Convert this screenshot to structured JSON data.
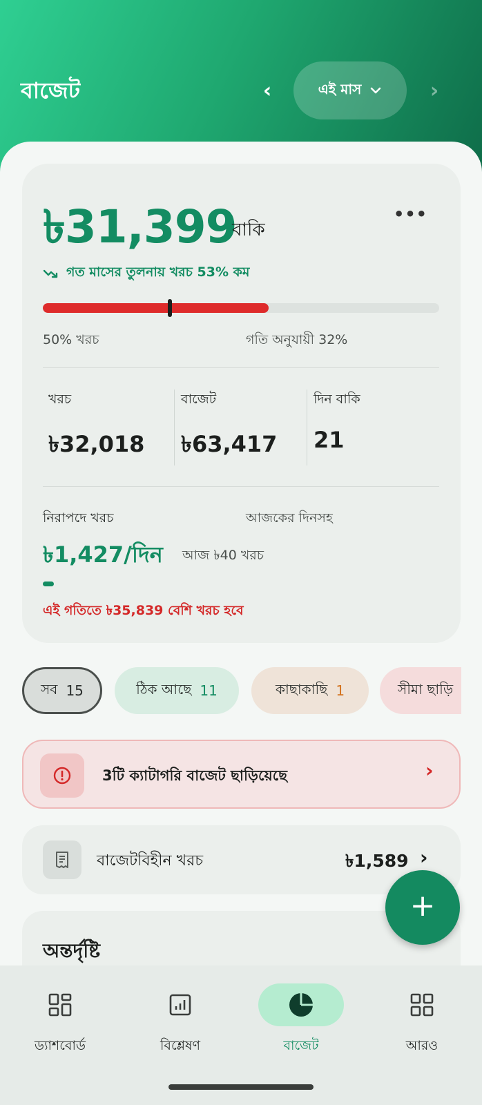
{
  "header": {
    "title": "বাজেট",
    "period_label": "এই মাস",
    "prev_icon": "chevron-left-icon",
    "next_icon": "chevron-right-icon"
  },
  "summary": {
    "remaining_amount": "৳31,399",
    "remaining_label": "বাকি",
    "trend_text": "গত মাসের তুলনায় খরচ 53% কম",
    "spent_percent": 57,
    "pace_marker_percent": 32,
    "spent_pct_label": "50% খরচ",
    "pace_label": "গতি অনুযায়ী 32%",
    "colors": {
      "accent": "#138c62",
      "danger": "#de2b2b"
    },
    "stats": [
      {
        "label": "খরচ",
        "value": "৳32,018"
      },
      {
        "label": "বাজেট",
        "value": "৳63,417"
      },
      {
        "label": "দিন বাকি",
        "value": "21"
      }
    ],
    "safe_spend_label": "নিরাপদে খরচ",
    "today_included_label": "আজকের দিনসহ",
    "daily_amount": "৳1,427/দিন",
    "today_spent": "আজ ৳40 খরচ",
    "warning_text": "এই গতিতে ৳35,839 বেশি খরচ হবে"
  },
  "filters": [
    {
      "label": "সব",
      "count": "15"
    },
    {
      "label": "ঠিক আছে",
      "count": "11"
    },
    {
      "label": "কাছাকাছি",
      "count": "1"
    },
    {
      "label": "সীমা ছাড়ি"
    }
  ],
  "alert": {
    "text": "3টি ক্যাটাগরি বাজেট ছাড়িয়েছে",
    "icon": "alert-circle-icon"
  },
  "unbudgeted": {
    "label": "বাজেটবিহীন খরচ",
    "amount": "৳1,589",
    "icon": "receipt-icon"
  },
  "insights": {
    "title": "অন্তর্দৃষ্টি"
  },
  "fab": {
    "label": "+"
  },
  "bottom_nav": [
    {
      "label": "ড্যাশবোর্ড",
      "icon": "dashboard-icon"
    },
    {
      "label": "বিশ্লেষণ",
      "icon": "analytics-icon"
    },
    {
      "label": "বাজেট",
      "icon": "budget-pie-icon",
      "active": true
    },
    {
      "label": "আরও",
      "icon": "more-grid-icon"
    }
  ]
}
